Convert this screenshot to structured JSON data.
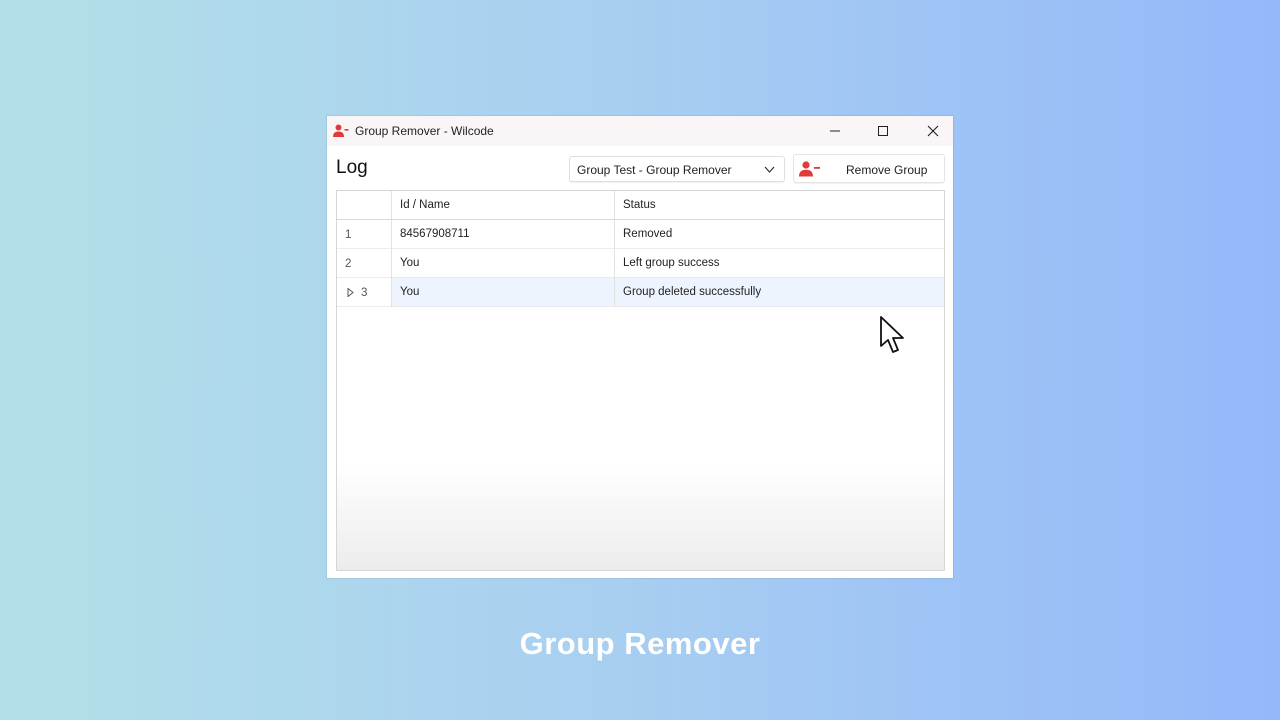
{
  "window": {
    "title": "Group Remover - Wilcode",
    "icon": "user-minus-icon",
    "controls": [
      "minimize-icon",
      "maximize-icon",
      "close-icon"
    ]
  },
  "toolbar": {
    "log_label": "Log",
    "group_select": {
      "selected": "Group Test - Group Remover"
    },
    "remove_button": {
      "label": "Remove Group",
      "icon": "user-minus-icon"
    }
  },
  "table": {
    "columns": [
      "Id / Name",
      "Status"
    ],
    "rows": [
      {
        "num": "1",
        "name": "84567908711",
        "status": "Removed"
      },
      {
        "num": "2",
        "name": "You",
        "status": "Left group success"
      },
      {
        "num": "3",
        "name": "You",
        "status": "Group deleted successfully"
      }
    ],
    "selected_row": 3
  },
  "caption": "Group Remover",
  "colors": {
    "accent_red": "#e03a3a",
    "selection": "#eef4fd"
  }
}
